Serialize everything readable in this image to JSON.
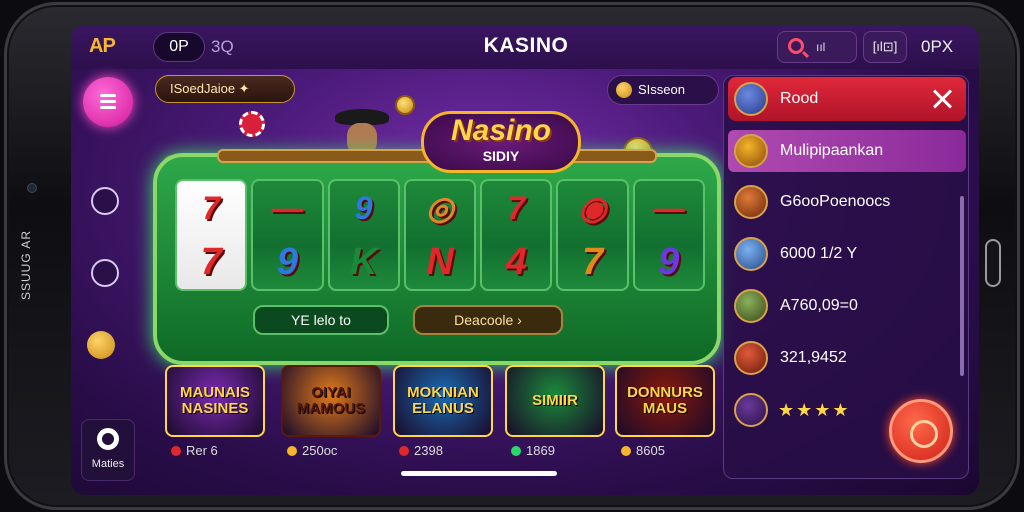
{
  "device": {
    "side_label": "SSUUG AR"
  },
  "topbar": {
    "logo": "AP",
    "pill_left": "0P",
    "search_text": "3Q",
    "title": "KASINO",
    "right_status": "ııl",
    "right_box": "[ıl⊡]",
    "right_text": "0PX"
  },
  "left_rail": {
    "settings_label": "Maties"
  },
  "center": {
    "chip_pill": "ISoedJaioe ✦",
    "coins_pill": "SIsseon",
    "game_logo_line1": "Nasino",
    "game_logo_line2": "SIDIY",
    "reels": [
      {
        "top": "7",
        "bottom": "7",
        "colors": [
          "#e0282a",
          "#e0282a"
        ]
      },
      {
        "top": "—",
        "bottom": "9",
        "colors": [
          "#e0282a",
          "#2a7ae0"
        ]
      },
      {
        "top": "9",
        "bottom": "K",
        "colors": [
          "#2a7ae0",
          "#1a8a3a"
        ]
      },
      {
        "top": "◎",
        "bottom": "N",
        "colors": [
          "#e0882a",
          "#e0282a"
        ]
      },
      {
        "top": "7",
        "bottom": "4",
        "colors": [
          "#e0282a",
          "#e0282a"
        ]
      },
      {
        "top": "◉",
        "bottom": "7",
        "colors": [
          "#e0282a",
          "#e08a1a"
        ]
      },
      {
        "top": "—",
        "bottom": "9",
        "colors": [
          "#e0282a",
          "#6a3ae0"
        ]
      }
    ],
    "btn_left": "YE lelo to",
    "btn_right": "Deacoole ›",
    "thumbnails": [
      {
        "title": "MAUNAIS NASINES",
        "caption": "Rer 6",
        "bg": "#7a2ab0",
        "fg": "#ffd64a",
        "dot": "#e0282a"
      },
      {
        "title": "OIYAI MAMOUS",
        "caption": "250oc",
        "bg": "#e07a1a",
        "fg": "#5a1a0a",
        "dot": "#f5b52a"
      },
      {
        "title": "MOKNIAN ELANUS",
        "caption": "2398",
        "bg": "#1a6ab0",
        "fg": "#ffd64a",
        "dot": "#e0282a"
      },
      {
        "title": "SIMIIR",
        "caption": "1869",
        "bg": "#1a8a3a",
        "fg": "#ffd64a",
        "dot": "#2ad86a"
      },
      {
        "title": "DONNURS MAUS",
        "caption": "8605",
        "bg": "#8a1a0a",
        "fg": "#ffd64a",
        "dot": "#f5b52a"
      }
    ]
  },
  "right_panel": {
    "items": [
      {
        "label": "Rood"
      },
      {
        "label": "Mulipipaankan"
      },
      {
        "label": "G6ooPoenoocs"
      },
      {
        "label": "6000 1/2 Y"
      },
      {
        "label": "A760,09=0"
      },
      {
        "label": "321,9452"
      },
      {
        "label": "★★★★"
      }
    ]
  },
  "colors": {
    "accent_magenta": "#d01a9a",
    "gold": "#f5b52a",
    "danger_red": "#e0283a",
    "bg_purple": "#4a1a78"
  }
}
